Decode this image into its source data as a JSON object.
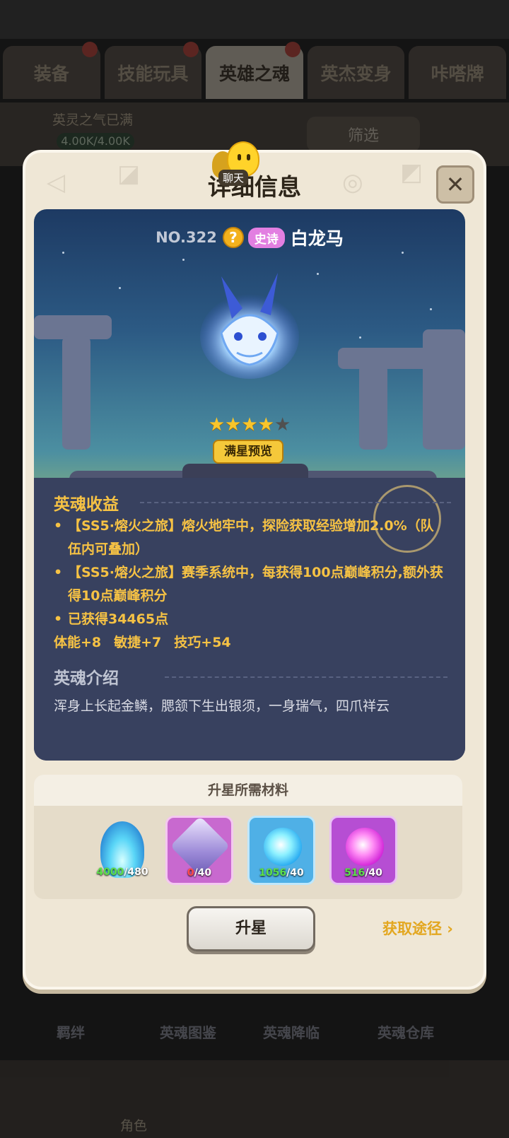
{
  "background": {
    "tabs": [
      "装备",
      "技能玩具",
      "英雄之魂",
      "英杰变身",
      "咔嗒牌"
    ],
    "active_tab_index": 2,
    "soul_label": "英灵之气已满",
    "soul_count": "4.00K/4.00K",
    "filter_label": "筛选",
    "sub_tabs": [
      "羁绊",
      "英魂图鉴",
      "英魂降临",
      "英魂仓库"
    ],
    "nav_label": "角色"
  },
  "chat": {
    "label": "聊天"
  },
  "modal": {
    "title": "详细信息",
    "close_icon": "close-icon",
    "hero": {
      "number": "NO.322",
      "rarity": "史诗",
      "rarity_color": "#e27fe1",
      "name": "白龙马",
      "stars_filled": 4,
      "stars_total": 5,
      "preview_label": "满星预览"
    },
    "benefits": {
      "title": "英魂收益",
      "items": [
        "【SS5·熔火之旅】熔火地牢中，探险获取经验增加2.0%（队伍内可叠加）",
        "【SS5·熔火之旅】赛季系统中，每获得100点巅峰积分,额外获得10点巅峰积分",
        "已获得34465点"
      ],
      "attributes": [
        "体能+8",
        "敏捷+7",
        "技巧+54"
      ]
    },
    "intro": {
      "title": "英魂介绍",
      "text": "浑身上长起金鳞，腮颔下生出银须，一身瑞气，四爪祥云"
    },
    "materials": {
      "title": "升星所需材料",
      "items": [
        {
          "icon": "blue-flame-icon",
          "have": "4000",
          "need": "/480",
          "enough": true
        },
        {
          "icon": "dragon-crystal-icon",
          "have": "0",
          "need": "/40",
          "enough": false
        },
        {
          "icon": "blue-orb-icon",
          "have": "1056",
          "need": "/40",
          "enough": true
        },
        {
          "icon": "pink-orb-icon",
          "have": "516",
          "need": "/40",
          "enough": true
        }
      ]
    },
    "upgrade_label": "升星",
    "source_label": "获取途径",
    "accent_color": "#f6c244"
  }
}
